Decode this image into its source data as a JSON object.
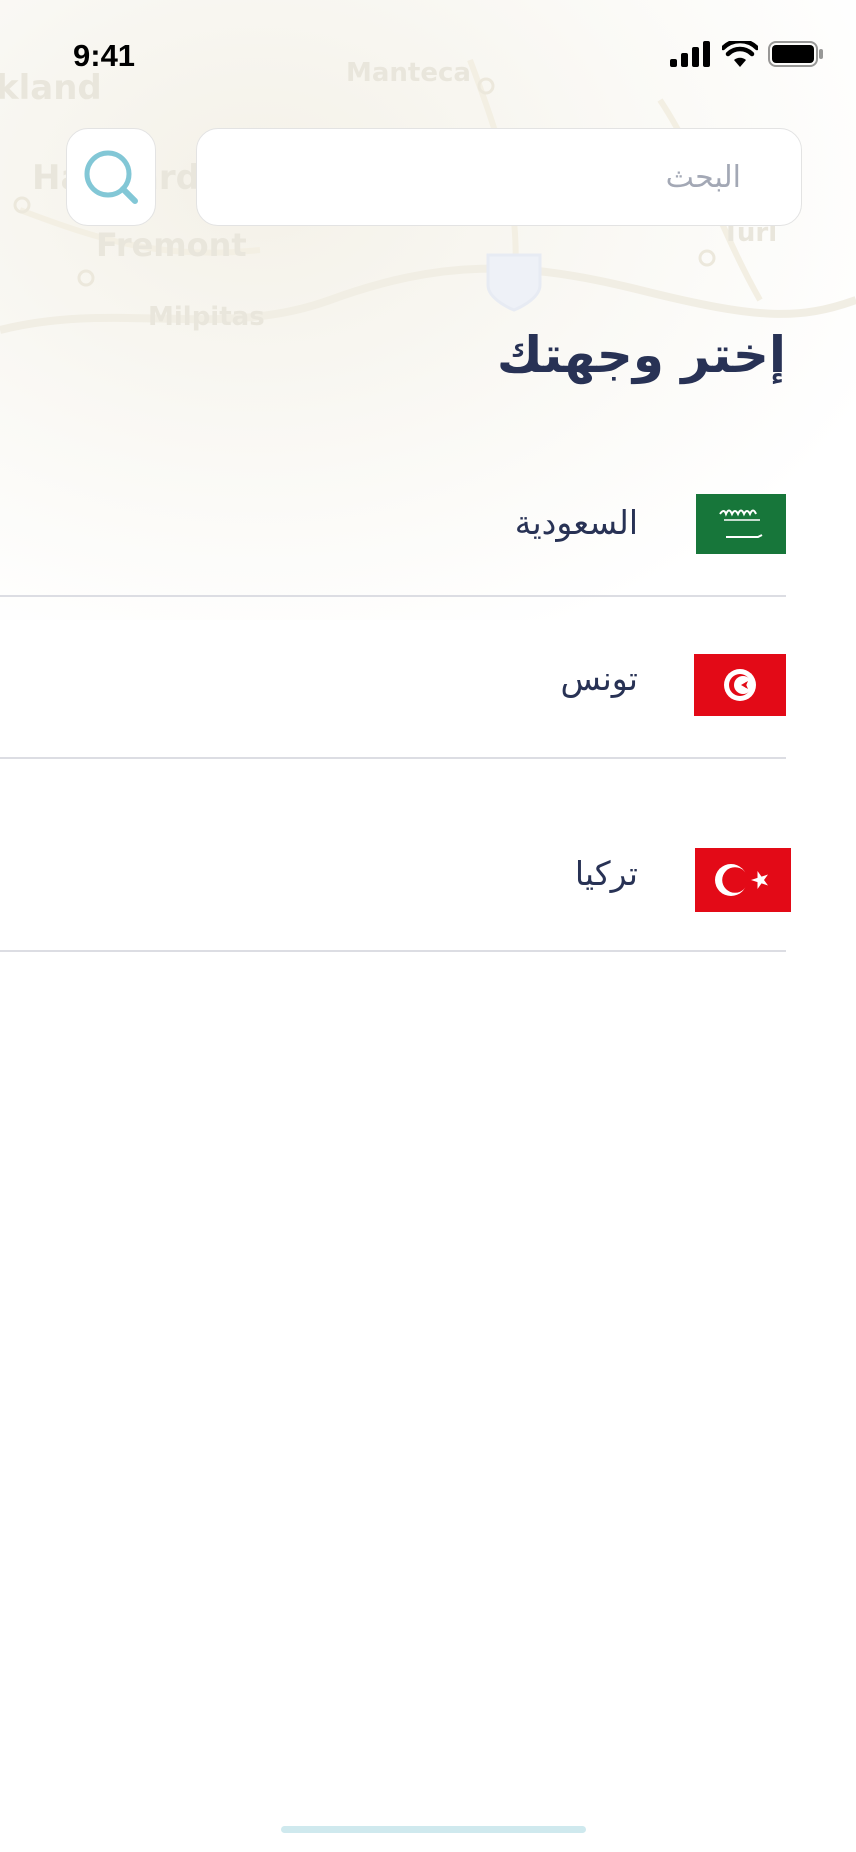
{
  "status_bar": {
    "time": "9:41"
  },
  "map_labels": [
    "kland",
    "Hayward",
    "Fremont",
    "Milpitas",
    "Manteca",
    "Turl"
  ],
  "search": {
    "placeholder": "البحث",
    "value": ""
  },
  "title": "إختر وجهتك",
  "countries": [
    {
      "name": "السعودية",
      "flag": "saudi-arabia-flag"
    },
    {
      "name": "تونس",
      "flag": "tunisia-flag"
    },
    {
      "name": "تركيا",
      "flag": "turkey-flag"
    }
  ],
  "colors": {
    "title": "#283255",
    "accent": "#82c7d6",
    "divider": "#dcdde3",
    "saudi_green": "#17763a",
    "flag_red": "#e30a17"
  }
}
